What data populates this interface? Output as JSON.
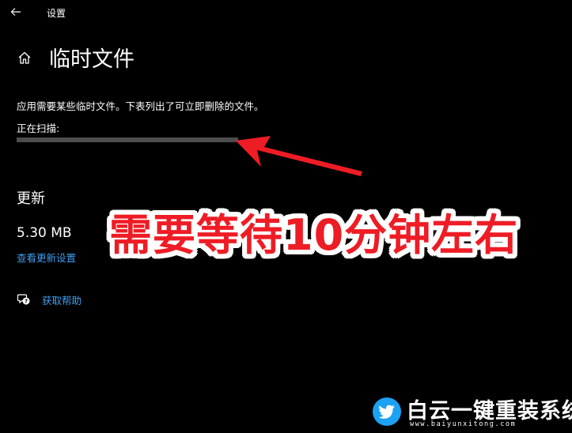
{
  "window": {
    "app_title": "设置",
    "back_icon": "back-arrow-icon"
  },
  "header": {
    "home_icon": "home-icon",
    "page_title": "临时文件"
  },
  "content": {
    "description": "应用需要某些临时文件。下表列出了可立即删除的文件。",
    "scan_label": "正在扫描:",
    "scan_progress_fraction": 1.0
  },
  "updates": {
    "title": "更新",
    "size": "5.30 MB",
    "link": "查看更新设置"
  },
  "help": {
    "icon": "help-chat-icon",
    "link": "获取帮助"
  },
  "annotation": {
    "callout": "需要等待10分钟左右",
    "arrow_icon": "red-arrow-icon",
    "color": "#ee1c25"
  },
  "watermark": {
    "logo_icon": "bird-logo-icon",
    "text": "白云一键重装系统",
    "url": "www.baiyunxitong.com",
    "logo_color": "#1da1f2"
  },
  "colors": {
    "background": "#000000",
    "text": "#ffffff",
    "link": "#3e9ff0",
    "progress_track": "#3a3a3a",
    "progress_fill": "#4d4d4d"
  }
}
